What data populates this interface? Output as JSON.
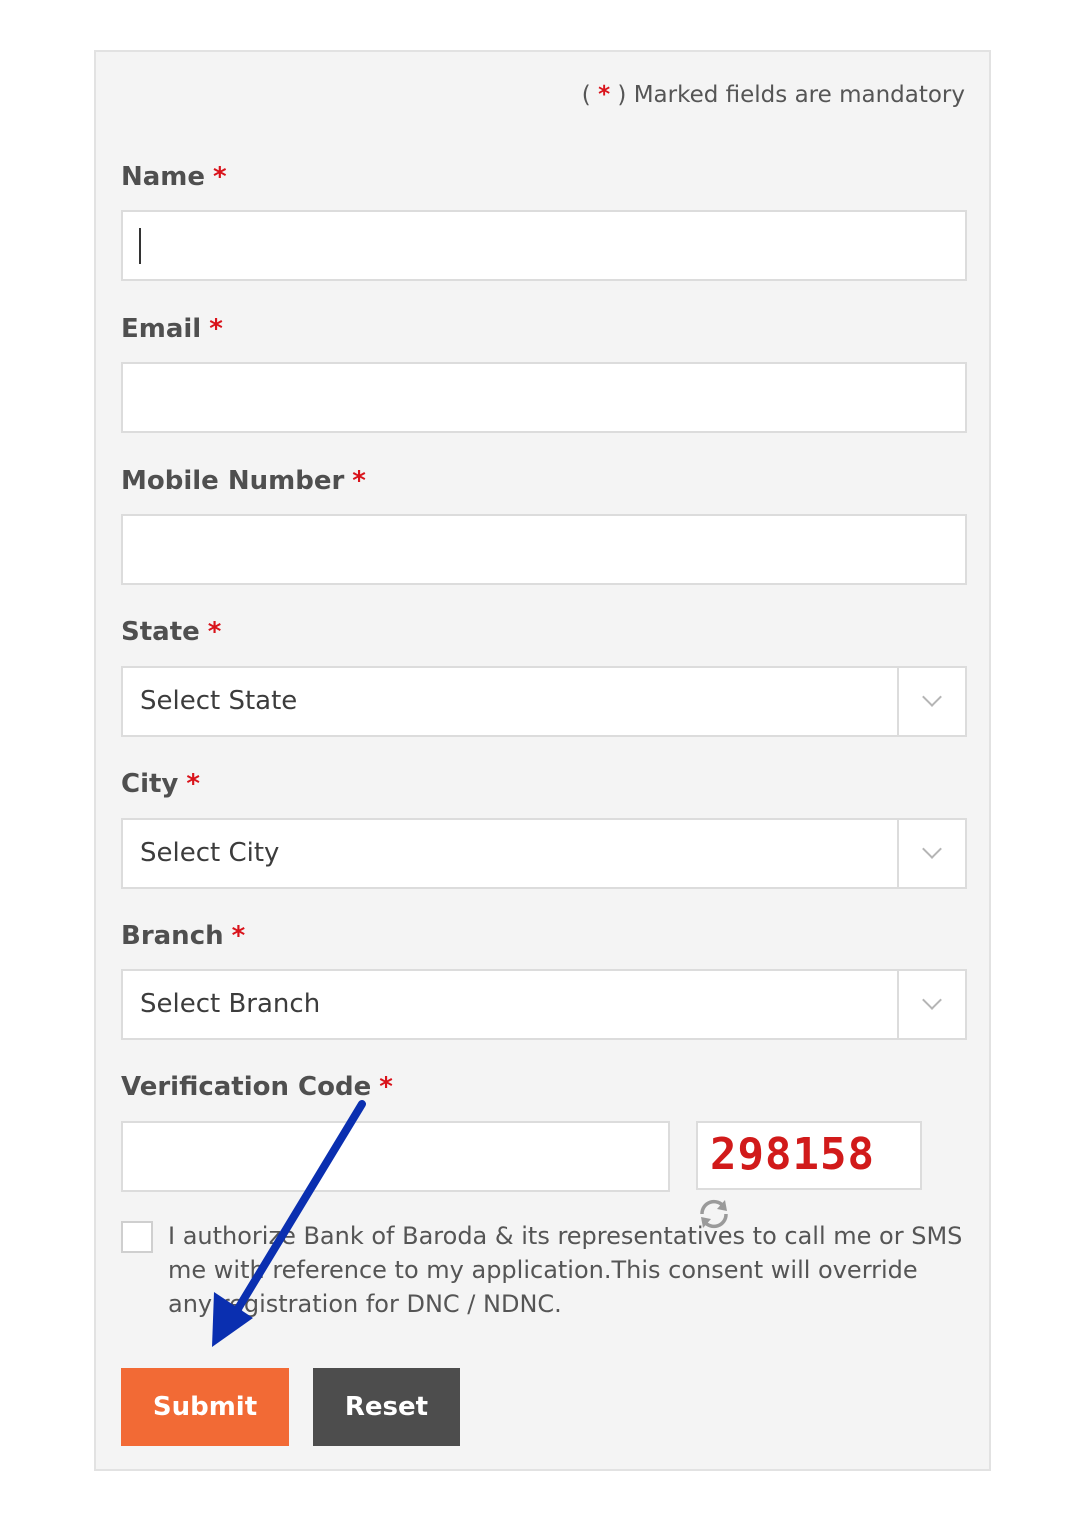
{
  "form": {
    "mandatory_note_prefix": "( ",
    "mandatory_note_star": "*",
    "mandatory_note_suffix": " ) Marked fields are mandatory",
    "required_marker": "*",
    "name": {
      "label": "Name",
      "value": ""
    },
    "email": {
      "label": "Email",
      "value": ""
    },
    "mobile": {
      "label": "Mobile Number",
      "value": ""
    },
    "state": {
      "label": "State",
      "selected": "Select State"
    },
    "city": {
      "label": "City",
      "selected": "Select City"
    },
    "branch": {
      "label": "Branch",
      "selected": "Select Branch"
    },
    "verification": {
      "label": "Verification Code",
      "value": "",
      "captcha": "298158"
    },
    "consent": {
      "checked": false,
      "text": "I authorize Bank of Baroda & its representatives to call me or SMS me with reference to my application.This consent will override any registration for DNC / NDNC."
    },
    "buttons": {
      "submit": "Submit",
      "reset": "Reset"
    }
  },
  "colors": {
    "required": "#d9131b",
    "submit_bg": "#f26a35",
    "reset_bg": "#4d4d4d",
    "captcha_text": "#d11a1a",
    "annotation_arrow": "#0a2fb0"
  },
  "icons": [
    "chevron-down-icon",
    "refresh-icon",
    "annotation-arrow"
  ]
}
